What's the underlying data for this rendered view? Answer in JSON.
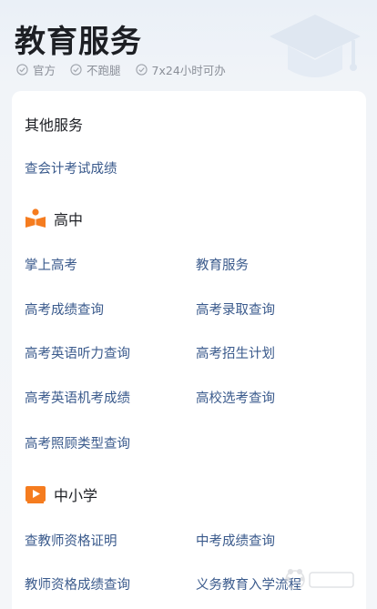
{
  "header": {
    "title": "教育服务",
    "tags": [
      "官方",
      "不跑腿",
      "7x24小时可办"
    ]
  },
  "sections": {
    "other": {
      "title": "其他服务",
      "links": [
        "查会计考试成绩"
      ]
    },
    "high_school": {
      "title": "高中",
      "links": [
        "掌上高考",
        "教育服务",
        "高考成绩查询",
        "高考录取查询",
        "高考英语听力查询",
        "高考招生计划",
        "高考英语机考成绩",
        "高校选考查询",
        "高考照顾类型查询"
      ]
    },
    "k12": {
      "title": "中小学",
      "links": [
        "查教师资格证明",
        "中考成绩查询",
        "教师资格成绩查询",
        "义务教育入学流程"
      ]
    }
  },
  "colors": {
    "accent_orange": "#f57c1f",
    "link_blue": "#3a5a8c",
    "title_dark": "#1d1f24",
    "tag_gray": "#8a8f98"
  },
  "icons": {
    "hero": "graduation-cap-icon",
    "tag": "check-circle-icon",
    "high_school": "book-reader-icon",
    "k12": "video-play-icon"
  }
}
